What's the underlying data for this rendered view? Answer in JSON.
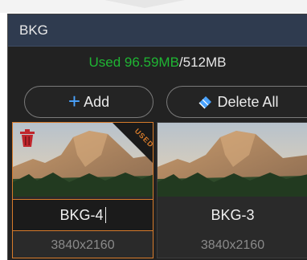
{
  "header": {
    "title": "BKG"
  },
  "usage": {
    "used": "Used 96.59MB",
    "total": "/512MB",
    "used_color": "#1fb533"
  },
  "buttons": {
    "add_label": "Add",
    "delete_all_label": "Delete All"
  },
  "items": [
    {
      "name": "BKG-4",
      "resolution": "3840x2160",
      "badge": "USED",
      "selected": true,
      "icons": [
        "trash-icon"
      ]
    },
    {
      "name": "BKG-3",
      "resolution": "3840x2160",
      "selected": false
    }
  ],
  "colors": {
    "accent": "#4aa3ff",
    "selection": "#d77b2b",
    "header_bg": "#2f3b4f",
    "panel_bg": "#222222"
  }
}
